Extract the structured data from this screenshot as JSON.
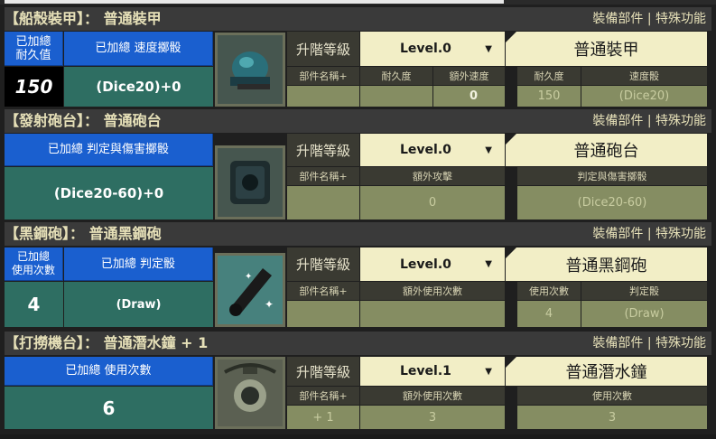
{
  "header_links": {
    "parts": "裝備部件",
    "sep": " | ",
    "special": "特殊功能"
  },
  "upgrade_label": "升階等級",
  "dropdown_arrow": "▼",
  "sections": [
    {
      "title": "【船殼裝甲】： 普通裝甲",
      "blue1": "已加總\n耐久值",
      "blue2": "已加總  速度擲骰",
      "value1": "150",
      "value2": "(Dice20)+0",
      "level": "Level.0",
      "name": "普通裝甲",
      "left_headers": [
        "部件名稱+",
        "耐久度",
        "額外速度"
      ],
      "left_values": [
        "",
        "",
        "0"
      ],
      "right_headers": [
        "耐久度",
        "速度骰"
      ],
      "right_values": [
        "150",
        "(Dice20)"
      ],
      "icon": "armor-helmet-icon"
    },
    {
      "title": "【發射砲台】： 普通砲台",
      "blue1": "已加總  判定與傷害擲骰",
      "value1": "(Dice20-60)+0",
      "level": "Level.0",
      "name": "普通砲台",
      "left_headers": [
        "部件名稱+",
        "額外攻擊"
      ],
      "left_values": [
        "",
        "0"
      ],
      "right_headers": [
        "判定與傷害擲骰"
      ],
      "right_values": [
        "(Dice20-60)"
      ],
      "icon": "cannon-turret-icon"
    },
    {
      "title": "【黑鋼砲】： 普通黑鋼砲",
      "blue1": "已加總\n使用次數",
      "blue2": "已加總  判定骰",
      "value1": "4",
      "value2": "(Draw)",
      "level": "Level.0",
      "name": "普通黑鋼砲",
      "left_headers": [
        "部件名稱+",
        "額外使用次數"
      ],
      "left_values": [
        "",
        ""
      ],
      "right_headers": [
        "使用次數",
        "判定骰"
      ],
      "right_values": [
        "4",
        "(Draw)"
      ],
      "icon": "black-steel-cannon-icon"
    },
    {
      "title": "【打撈機台】： 普通潛水鐘 + 1",
      "blue1": "已加總  使用次數",
      "value1": "6",
      "level": "Level.1",
      "name": "普通潛水鐘",
      "left_headers": [
        "部件名稱+",
        "額外使用次數"
      ],
      "left_values": [
        "+ 1",
        "3"
      ],
      "right_headers": [
        "使用次數"
      ],
      "right_values": [
        "3"
      ],
      "icon": "diving-bell-icon"
    }
  ]
}
